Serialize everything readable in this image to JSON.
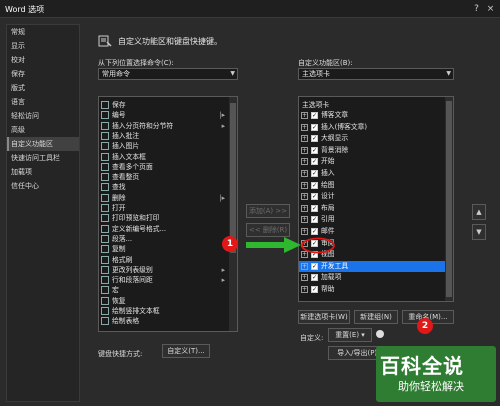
{
  "window": {
    "title": "Word 选项",
    "help_icon": "?",
    "close_icon": "×"
  },
  "sidebar": {
    "items": [
      {
        "label": "常规"
      },
      {
        "label": "显示"
      },
      {
        "label": "校对"
      },
      {
        "label": "保存"
      },
      {
        "label": "版式"
      },
      {
        "label": "语言"
      },
      {
        "label": "轻松访问"
      },
      {
        "label": "高级"
      },
      {
        "label": "自定义功能区"
      },
      {
        "label": "快速访问工具栏"
      },
      {
        "label": "加载项"
      },
      {
        "label": "信任中心"
      }
    ],
    "selected_index": 8
  },
  "header": {
    "title": "自定义功能区和键盘快捷键。"
  },
  "left": {
    "choose_label": "从下列位置选择命令(C):",
    "choose_value": "常用命令",
    "commands": [
      {
        "label": "保存",
        "icon": "save-icon"
      },
      {
        "label": "编号",
        "icon": "numbering-icon",
        "sub": "|▸"
      },
      {
        "label": "插入分页符和分节符",
        "icon": "page-break-icon",
        "sub": "▸"
      },
      {
        "label": "插入批注",
        "icon": "comment-icon"
      },
      {
        "label": "插入图片",
        "icon": "picture-icon"
      },
      {
        "label": "插入文本框",
        "icon": "textbox-icon"
      },
      {
        "label": "查看多个页面",
        "icon": "multipage-icon"
      },
      {
        "label": "查看整页",
        "icon": "onepage-icon"
      },
      {
        "label": "查找",
        "icon": "find-icon"
      },
      {
        "label": "删除",
        "icon": "delete-icon",
        "sub": "|▸"
      },
      {
        "label": "打开",
        "icon": "open-icon"
      },
      {
        "label": "打印预览和打印",
        "icon": "print-icon"
      },
      {
        "label": "定义新编号格式...",
        "icon": "newformat-icon"
      },
      {
        "label": "段落...",
        "icon": "paragraph-icon"
      },
      {
        "label": "复制",
        "icon": "copy-icon"
      },
      {
        "label": "格式刷",
        "icon": "formatpainter-icon"
      },
      {
        "label": "更改列表级别",
        "icon": "listlevel-icon",
        "sub": "▸"
      },
      {
        "label": "行和段落间距",
        "icon": "spacing-icon",
        "sub": "▸"
      },
      {
        "label": "宏",
        "icon": "macro-icon"
      },
      {
        "label": "恢复",
        "icon": "redo-icon"
      },
      {
        "label": "绘制竖排文本框",
        "icon": "vtextbox-icon"
      },
      {
        "label": "绘制表格",
        "icon": "drawtable-icon"
      }
    ],
    "shortcut_label": "键盘快捷方式:",
    "customize_button": "自定义(T)..."
  },
  "middle": {
    "add_button": "添加(A) >>",
    "remove_button": "<< 删除(R)"
  },
  "right": {
    "customize_label": "自定义功能区(B):",
    "tab_value": "主选项卡",
    "tree_header": "主选项卡",
    "tabs": [
      {
        "label": "博客文章"
      },
      {
        "label": "插入(博客文章)"
      },
      {
        "label": "大纲显示"
      },
      {
        "label": "背景消除"
      },
      {
        "label": "开始"
      },
      {
        "label": "插入"
      },
      {
        "label": "绘图"
      },
      {
        "label": "设计"
      },
      {
        "label": "布局"
      },
      {
        "label": "引用"
      },
      {
        "label": "邮件"
      },
      {
        "label": "审阅"
      },
      {
        "label": "视图"
      },
      {
        "label": "开发工具"
      },
      {
        "label": "加载项"
      },
      {
        "label": "帮助"
      }
    ],
    "highlighted_index": 13,
    "new_tab_button": "新建选项卡(W)",
    "new_group_button": "新建组(N)",
    "rename_button": "重命名(M)...",
    "customize_label2": "自定义:",
    "reset_button": "重置(E) ▾",
    "import_export_button": "导入/导出(P) ▾"
  },
  "annotations": {
    "badge1": "1",
    "badge2": "2"
  },
  "watermark": {
    "line1": "百科全说",
    "line2": "助你轻松解决"
  },
  "colors": {
    "highlight": "#1a73e8",
    "badge": "#e01818",
    "arrow": "#2fb72f"
  }
}
